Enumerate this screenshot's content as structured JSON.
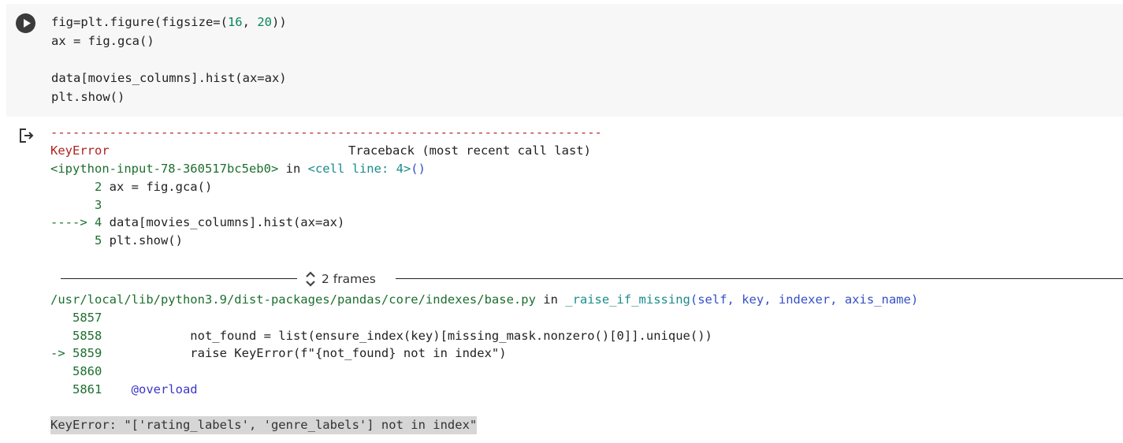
{
  "code_cell": {
    "lines": [
      {
        "pre": "fig=plt.figure(figsize=(",
        "n1": "16",
        "mid": ", ",
        "n2": "20",
        "post": "))"
      },
      {
        "text": "ax = fig.gca()"
      },
      {
        "text": ""
      },
      {
        "text": "data[movies_columns].hist(ax=ax)"
      },
      {
        "text": "plt.show()"
      }
    ]
  },
  "output": {
    "divider": "---------------------------------------------------------------------------",
    "error_name": "KeyError",
    "traceback_label": "Traceback (most recent call last)",
    "input_ref": "<ipython-input-78-360517bc5eb0>",
    "in_word": " in ",
    "cell_line": "<cell line: 4>",
    "cell_line_suffix": "()",
    "tb1": [
      {
        "prefix": "      2 ",
        "code": "ax = fig.gca()"
      },
      {
        "prefix": "      3",
        "code": ""
      },
      {
        "prefix": "----> 4 ",
        "code": "data[movies_columns].hist(ax=ax)"
      },
      {
        "prefix": "      5 ",
        "code": "plt.show()"
      }
    ],
    "frames_label": "2 frames",
    "file_path": "/usr/local/lib/python3.9/dist-packages/pandas/core/indexes/base.py",
    "func_name": "_raise_if_missing",
    "func_args": "(self, key, indexer, axis_name)",
    "tb2": [
      {
        "prefix": "   5857",
        "code": ""
      },
      {
        "prefix": "   5858",
        "code": "            not_found = list(ensure_index(key)[missing_mask.nonzero()[0]].unique())"
      },
      {
        "prefix": "-> 5859",
        "code": "            raise KeyError(f\"{not_found} not in index\")"
      },
      {
        "prefix": "   5860",
        "code": ""
      },
      {
        "prefix": "   5861",
        "code": "    @overload"
      }
    ],
    "final_error": "KeyError: \"['rating_labels', 'genre_labels'] not in index\""
  },
  "icons": {
    "run": "play-icon",
    "output": "output-arrow-icon",
    "frames": "expand-chevrons-icon"
  }
}
